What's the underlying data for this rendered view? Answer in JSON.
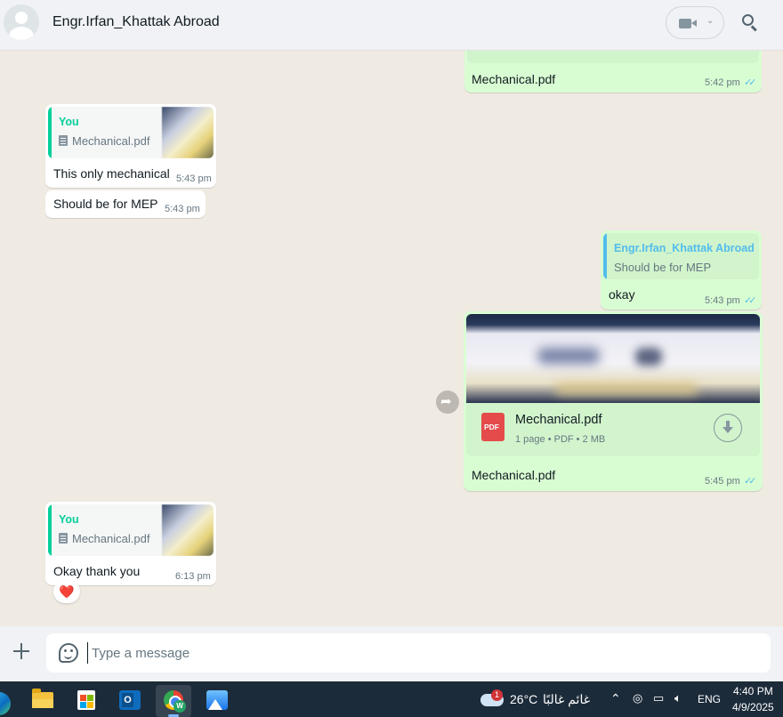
{
  "header": {
    "contact_name": "Engr.Irfan_Khattak Abroad"
  },
  "messages": {
    "m1": {
      "text": "Mechanical.pdf",
      "time": "5:42 pm"
    },
    "m2": {
      "quote_author": "You",
      "quote_doc": "Mechanical.pdf",
      "text": "This only mechanical",
      "time": "5:43 pm"
    },
    "m3": {
      "text": "Should be for MEP",
      "time": "5:43 pm"
    },
    "m4": {
      "quote_author": "Engr.Irfan_Khattak Abroad",
      "quote_text": "Should be for MEP",
      "text": "okay",
      "time": "5:43 pm"
    },
    "m5": {
      "doc_name": "Mechanical.pdf",
      "doc_meta": "1 page • PDF • 2 MB",
      "pdf_label": "PDF",
      "caption": "Mechanical.pdf",
      "time": "5:45 pm"
    },
    "m6": {
      "quote_author": "You",
      "quote_doc": "Mechanical.pdf",
      "text": "Okay thank you",
      "time": "6:13 pm",
      "reaction": "❤️"
    }
  },
  "composer": {
    "placeholder": "Type a message"
  },
  "taskbar": {
    "weather_temp": "26°C",
    "weather_desc": "غائم غالبًا",
    "weather_badge": "1",
    "language": "ENG",
    "time": "4:40 PM",
    "date": "4/9/2025"
  },
  "colors": {
    "outgoing_bubble": "#d9fdd3",
    "incoming_bubble": "#ffffff",
    "you_author": "#06cf9c",
    "contact_author": "#53bdeb",
    "read_ticks": "#53bdeb",
    "chat_background": "#efeae2"
  },
  "icons": {
    "header": [
      "avatar-icon",
      "video-call-icon",
      "chevron-down-icon",
      "search-icon"
    ],
    "composer": [
      "plus-icon",
      "sticker-icon"
    ],
    "message": [
      "document-icon",
      "pdf-icon",
      "download-icon",
      "forward-icon",
      "read-ticks-icon"
    ]
  }
}
